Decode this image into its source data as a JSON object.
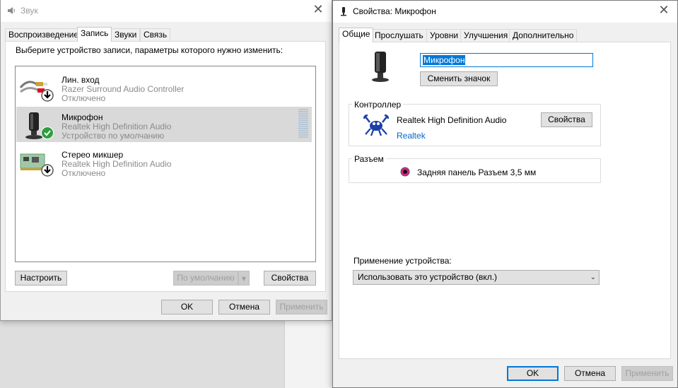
{
  "sound_window": {
    "title": "Звук",
    "tabs": [
      {
        "label": "Воспроизведение"
      },
      {
        "label": "Запись"
      },
      {
        "label": "Звуки"
      },
      {
        "label": "Связь"
      }
    ],
    "instruction": "Выберите устройство записи, параметры которого нужно изменить:",
    "devices": [
      {
        "name": "Лин. вход",
        "driver": "Razer Surround Audio Controller",
        "status": "Отключено",
        "icon": "line-in-jack-icon"
      },
      {
        "name": "Микрофон",
        "driver": "Realtek High Definition Audio",
        "status": "Устройство по умолчанию",
        "icon": "microphone-icon"
      },
      {
        "name": "Стерео микшер",
        "driver": "Realtek High Definition Audio",
        "status": "Отключено",
        "icon": "sound-card-icon"
      }
    ],
    "buttons": {
      "configure": "Настроить",
      "set_default": "По умолчанию",
      "properties": "Свойства",
      "ok": "OK",
      "cancel": "Отмена",
      "apply": "Применить"
    }
  },
  "props_window": {
    "title": "Свойства: Микрофон",
    "tabs": [
      {
        "label": "Общие"
      },
      {
        "label": "Прослушать"
      },
      {
        "label": "Уровни"
      },
      {
        "label": "Улучшения"
      },
      {
        "label": "Дополнительно"
      }
    ],
    "device_name": "Микрофон",
    "change_icon": "Сменить значок",
    "controller": {
      "label": "Контроллер",
      "name": "Realtek High Definition Audio",
      "vendor": "Realtek",
      "properties": "Свойства"
    },
    "jack": {
      "label": "Разъем",
      "description": "Задняя панель Разъем 3,5 мм",
      "color": "#e0218a"
    },
    "usage": {
      "label": "Применение устройства:",
      "selected": "Использовать это устройство (вкл.)"
    },
    "buttons": {
      "ok": "OK",
      "cancel": "Отмена",
      "apply": "Применить"
    }
  },
  "colors": {
    "accent": "#0078d7",
    "default_check": "#2e9e3e"
  }
}
